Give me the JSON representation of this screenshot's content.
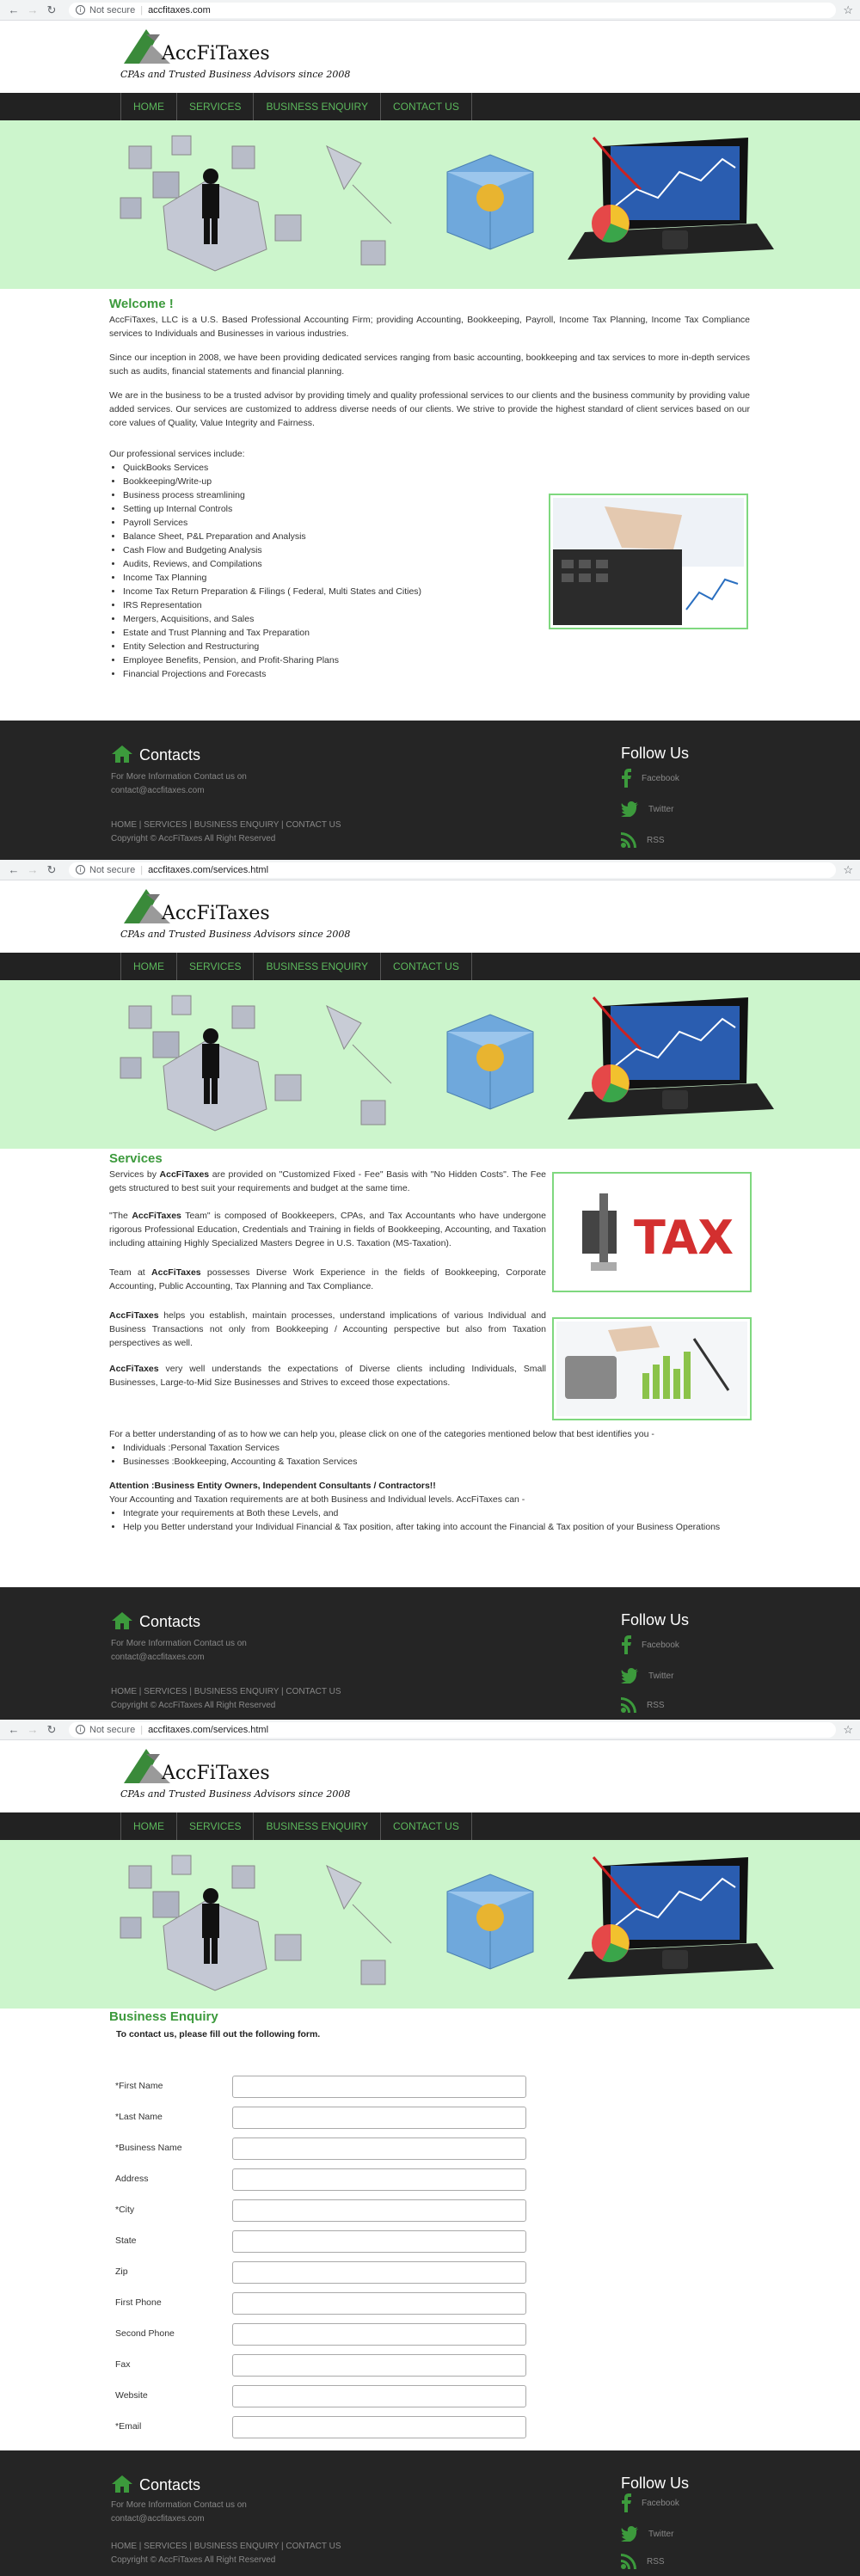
{
  "browser": [
    {
      "url": "accfitaxes.com",
      "secure_label": "Not secure"
    },
    {
      "url": "accfitaxes.com/services.html",
      "secure_label": "Not secure"
    },
    {
      "url": "accfitaxes.com/services.html",
      "secure_label": "Not secure"
    }
  ],
  "logo": {
    "name": "AccFiTaxes",
    "tagline": "CPAs and Trusted Business Advisors since 2008"
  },
  "nav": {
    "items": [
      "HOME",
      "SERVICES",
      "BUSINESS ENQUIRY",
      "CONTACT US"
    ]
  },
  "home": {
    "title": "Welcome !",
    "p1": "AccFiTaxes, LLC is a U.S. Based Professional Accounting Firm; providing Accounting, Bookkeeping, Payroll, Income Tax Planning, Income Tax Compliance services to Individuals and Businesses in various industries.",
    "p2": "Since our inception in 2008, we have been providing dedicated services ranging from basic accounting, bookkeeping and tax services to more in-depth services such as audits, financial statements and financial planning.",
    "p3": "We are in the business to be a trusted advisor by providing timely and quality professional services to our clients and the business community by providing value added services. Our services are customized to address diverse needs of our clients. We strive to provide the highest standard of client services based on our core values of Quality, Value Integrity and Fairness.",
    "services_intro": "Our professional services include:",
    "services": [
      "QuickBooks Services",
      "Bookkeeping/Write-up",
      "Business process streamlining",
      "Setting up Internal Controls",
      "Payroll Services",
      "Balance Sheet, P&L Preparation and Analysis",
      "Cash Flow and Budgeting Analysis",
      "Audits, Reviews, and Compilations",
      "Income Tax Planning",
      "Income Tax Return Preparation & Filings ( Federal, Multi States and Cities)",
      "IRS Representation",
      "Mergers, Acquisitions, and Sales",
      "Estate and Trust Planning and Tax Preparation",
      "Entity Selection and Restructuring",
      "Employee Benefits, Pension, and Profit-Sharing Plans",
      "Financial Projections and Forecasts"
    ]
  },
  "services_page": {
    "title": "Services",
    "p1a": "Services by ",
    "p1b": "AccFiTaxes",
    "p1c": " are provided on \"Customized Fixed - Fee\" Basis with \"No Hidden Costs\". The Fee gets structured to best suit your requirements and budget at the same time.",
    "p2a": "\"The ",
    "p2b": "AccFiTaxes",
    "p2c": " Team\" is composed of Bookkeepers, CPAs, and Tax Accountants who have undergone rigorous Professional Education, Credentials and Training in fields of Bookkeeping, Accounting, and Taxation including attaining Highly Specialized Masters Degree in U.S. Taxation (MS-Taxation).",
    "p3a": "Team at ",
    "p3b": "AccFiTaxes",
    "p3c": " possesses Diverse Work Experience in the fields of Bookkeeping, Corporate Accounting, Public Accounting, Tax Planning and Tax Compliance.",
    "p4b": "AccFiTaxes",
    "p4c": " helps you establish, maintain processes, understand implications of various Individual and Business Transactions not only from Bookkeeping / Accounting perspective but also from Taxation perspectives as well.",
    "p5b": "AccFiTaxes",
    "p5c": " very well understands the expectations of Diverse clients including Individuals, Small Businesses, Large-to-Mid Size Businesses and Strives to exceed those expectations.",
    "p6": "For a better understanding of as to how we can help you, please click on one of the categories mentioned below that best identifies you -",
    "categories": [
      "Individuals :Personal Taxation Services",
      "Businesses :Bookkeeping, Accounting & Taxation Services"
    ],
    "attention": "Attention :Business Entity Owners, Independent Consultants / Contractors!!",
    "p7": "Your Accounting and Taxation requirements are at both Business and Individual levels. AccFiTaxes can -",
    "benefits": [
      "Integrate your requirements at Both these Levels, and",
      "Help you Better understand your Individual Financial & Tax position, after taking into account the Financial & Tax position of your Business Operations"
    ],
    "tax_image_text": "TAX"
  },
  "enquiry": {
    "title": "Business Enquiry",
    "subtitle": "To contact us, please fill out the following form.",
    "fields": [
      "*First Name",
      "*Last Name",
      "*Business Name",
      "Address",
      "*City",
      "State",
      "Zip",
      "First Phone",
      "Second Phone",
      "Fax",
      "Website",
      "*Email"
    ]
  },
  "footer": {
    "contacts_title": "Contacts",
    "info1": "For More Information Contact us on",
    "email": "contact@accfitaxes.com",
    "links": [
      "HOME",
      "SERVICES",
      "BUSINESS ENQUIRY",
      "CONTACT US"
    ],
    "copyright": "Copyright © AccFiTaxes All Right Reserved",
    "follow_title": "Follow Us",
    "social": [
      "Facebook",
      "Twitter",
      "RSS"
    ]
  },
  "colors": {
    "accent": "#3c9a3c",
    "nav_bg": "#222222",
    "banner_bg": "#ccf5cc",
    "footer_bg": "#252525"
  }
}
